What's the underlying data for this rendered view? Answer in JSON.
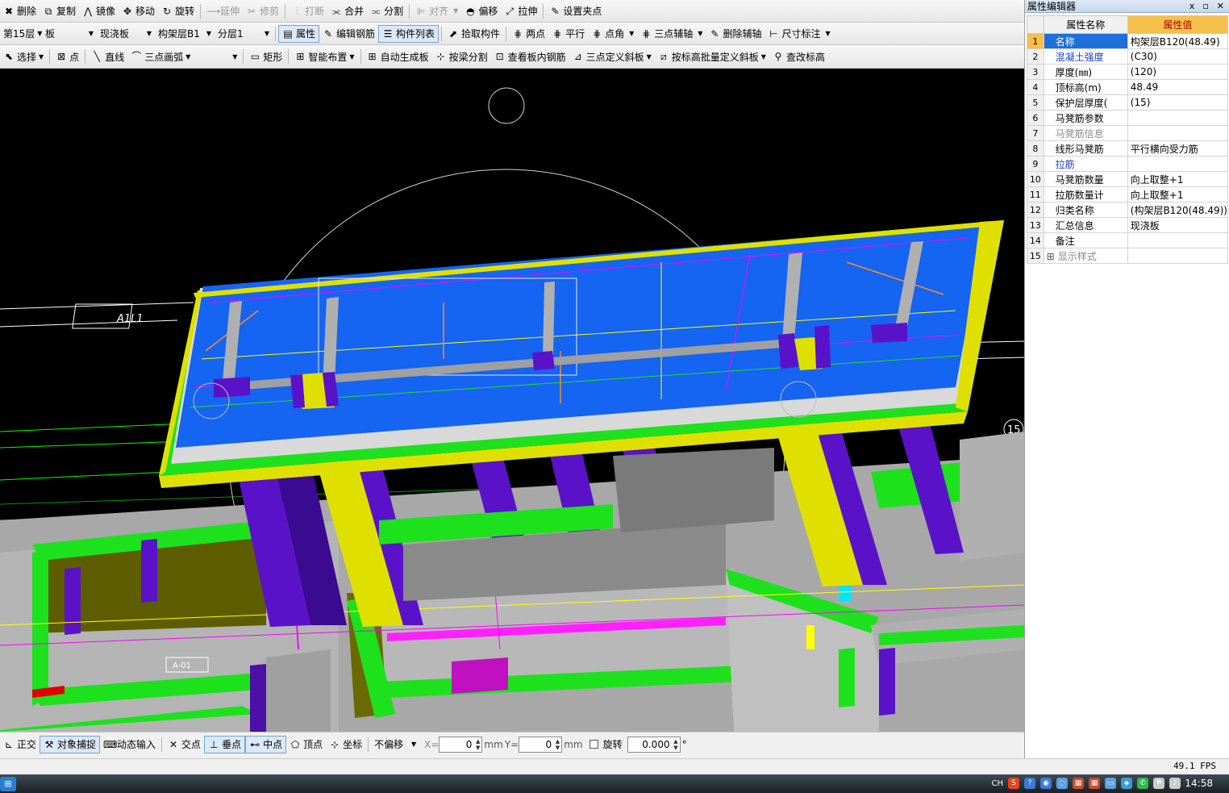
{
  "toolbar1": {
    "items": [
      {
        "label": "删除",
        "icon": "✖",
        "disabled": false
      },
      {
        "label": "复制",
        "icon": "⧉",
        "disabled": false
      },
      {
        "label": "镜像",
        "icon": "⋀",
        "disabled": false
      },
      {
        "label": "移动",
        "icon": "✥",
        "disabled": false
      },
      {
        "label": "旋转",
        "icon": "↻",
        "disabled": false
      },
      {
        "label": "延伸",
        "icon": "⟶",
        "disabled": true
      },
      {
        "label": "修剪",
        "icon": "✂",
        "disabled": true
      },
      {
        "label": "打断",
        "icon": "⫶",
        "disabled": true
      },
      {
        "label": "合并",
        "icon": "⫘",
        "disabled": false
      },
      {
        "label": "分割",
        "icon": "⫗",
        "disabled": false
      },
      {
        "label": "对齐",
        "icon": "⊫",
        "disabled": true,
        "dropdown": true
      },
      {
        "label": "偏移",
        "icon": "◓",
        "disabled": false
      },
      {
        "label": "拉伸",
        "icon": "⤢",
        "disabled": false
      },
      {
        "label": "设置夹点",
        "icon": "✎",
        "disabled": false
      }
    ]
  },
  "toolbar2": {
    "floor": "第15层",
    "category": "板",
    "type": "现浇板",
    "component": "构架层B1",
    "layer": "分层1",
    "buttons": [
      {
        "label": "属性",
        "icon": "▤",
        "pressed": true
      },
      {
        "label": "编辑钢筋",
        "icon": "✎",
        "pressed": false
      },
      {
        "label": "构件列表",
        "icon": "☰",
        "pressed": true
      },
      {
        "label": "拾取构件",
        "icon": "⬈",
        "pressed": false
      },
      {
        "label": "两点",
        "icon": "⋕",
        "pressed": false
      },
      {
        "label": "平行",
        "icon": "⋕",
        "pressed": false
      },
      {
        "label": "点角",
        "icon": "⋕",
        "pressed": false,
        "dropdown": true
      },
      {
        "label": "三点辅轴",
        "icon": "⋕",
        "pressed": false,
        "dropdown": true
      },
      {
        "label": "删除辅轴",
        "icon": "✎",
        "pressed": false
      },
      {
        "label": "尺寸标注",
        "icon": "⊢",
        "pressed": false,
        "dropdown": true
      }
    ]
  },
  "toolbar3": {
    "items": [
      {
        "label": "选择",
        "icon": "⬉",
        "dropdown": true
      },
      {
        "label": "点",
        "icon": "⊠",
        "dropdown": false
      },
      {
        "label": "直线",
        "icon": "╲",
        "dropdown": false
      },
      {
        "label": "三点画弧",
        "icon": "⌒",
        "dropdown": true
      },
      {
        "label": "",
        "icon": "",
        "dropdown": true
      },
      {
        "label": "矩形",
        "icon": "▭",
        "dropdown": false
      },
      {
        "label": "智能布置",
        "icon": "⊞",
        "dropdown": true
      },
      {
        "label": "自动生成板",
        "icon": "⊞",
        "dropdown": false
      },
      {
        "label": "按梁分割",
        "icon": "⊹",
        "dropdown": false
      },
      {
        "label": "查看板内钢筋",
        "icon": "⊡",
        "dropdown": false
      },
      {
        "label": "三点定义斜板",
        "icon": "⊿",
        "dropdown": true
      },
      {
        "label": "按标高批量定义斜板",
        "icon": "⧄",
        "dropdown": true
      },
      {
        "label": "查改标高",
        "icon": "⚲",
        "dropdown": false
      }
    ]
  },
  "viewport": {
    "axis_label": "A1L1",
    "axis_number": "15",
    "room_label": "A-01"
  },
  "property_panel": {
    "title": "属性编辑器",
    "controls": [
      "ⅹ",
      "▫",
      "✕"
    ],
    "headers": {
      "name": "属性名称",
      "value": "属性值"
    },
    "rows": [
      {
        "num": "1",
        "name": "名称",
        "value": "构架层B120(48.49)",
        "style": "blue",
        "selected": true
      },
      {
        "num": "2",
        "name": "混凝土强度",
        "value": "(C30)",
        "style": "blue"
      },
      {
        "num": "3",
        "name": "厚度(㎜)",
        "value": "(120)",
        "style": ""
      },
      {
        "num": "4",
        "name": "顶标高(m)",
        "value": "48.49",
        "style": ""
      },
      {
        "num": "5",
        "name": "保护层厚度(",
        "value": "(15)",
        "style": ""
      },
      {
        "num": "6",
        "name": "马凳筋参数",
        "value": "",
        "style": ""
      },
      {
        "num": "7",
        "name": "马凳筋信息",
        "value": "",
        "style": "gray"
      },
      {
        "num": "8",
        "name": "线形马凳筋",
        "value": "平行横向受力筋",
        "style": ""
      },
      {
        "num": "9",
        "name": "拉筋",
        "value": "",
        "style": "blue"
      },
      {
        "num": "10",
        "name": "马凳筋数量",
        "value": "向上取整+1",
        "style": ""
      },
      {
        "num": "11",
        "name": "拉筋数量计",
        "value": "向上取整+1",
        "style": ""
      },
      {
        "num": "12",
        "name": "归类名称",
        "value": "(构架层B120(48.49))",
        "style": ""
      },
      {
        "num": "13",
        "name": "汇总信息",
        "value": "现浇板",
        "style": ""
      },
      {
        "num": "14",
        "name": "备注",
        "value": "",
        "style": ""
      },
      {
        "num": "15",
        "name": "显示样式",
        "value": "",
        "style": "gray",
        "expandable": true
      }
    ]
  },
  "status_bar": {
    "buttons": [
      {
        "label": "正交",
        "icon": "⊾",
        "pressed": false
      },
      {
        "label": "对象捕捉",
        "icon": "⚒",
        "pressed": true
      },
      {
        "label": "动态输入",
        "icon": "⌨",
        "pressed": false
      },
      {
        "label": "交点",
        "icon": "✕",
        "pressed": false
      },
      {
        "label": "垂点",
        "icon": "⊥",
        "pressed": true
      },
      {
        "label": "中点",
        "icon": "⊷",
        "pressed": true
      },
      {
        "label": "顶点",
        "icon": "⬠",
        "pressed": false
      },
      {
        "label": "坐标",
        "icon": "⊹",
        "pressed": false
      }
    ],
    "offset_mode": "不偏移",
    "x_label": "X=",
    "x_value": "0",
    "y_label": "Y=",
    "y_value": "0",
    "unit": "mm",
    "rotate_label": "旋转",
    "rotate_value": "0.000",
    "degree": "°"
  },
  "fps": "49.1 FPS",
  "taskbar": {
    "lang": "CH",
    "clock": "14:58",
    "tray_icons": [
      {
        "name": "sogou",
        "glyph": "S",
        "color": "#e8431b"
      },
      {
        "name": "help",
        "glyph": "?",
        "color": "#3a7bd5"
      },
      {
        "name": "user",
        "glyph": "◉",
        "color": "#3a7bd5"
      },
      {
        "name": "network",
        "glyph": "◌",
        "color": "#5aa0e0"
      },
      {
        "name": "app-a",
        "glyph": "▦",
        "color": "#d04a2a"
      },
      {
        "name": "app-b",
        "glyph": "▦",
        "color": "#d04a2a"
      },
      {
        "name": "monitor",
        "glyph": "▭",
        "color": "#5aa0e0"
      },
      {
        "name": "shield",
        "glyph": "◈",
        "color": "#3a9ad5"
      },
      {
        "name": "wechat",
        "glyph": "✆",
        "color": "#2fb84a"
      },
      {
        "name": "flag",
        "glyph": "⚑",
        "color": "#cccccc"
      },
      {
        "name": "volume",
        "glyph": "♪",
        "color": "#cccccc"
      }
    ]
  }
}
